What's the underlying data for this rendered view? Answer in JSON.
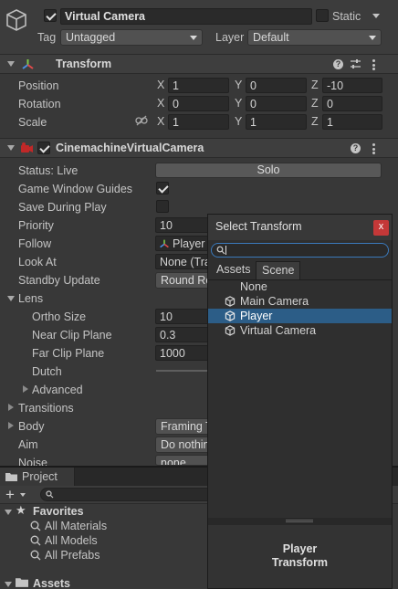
{
  "object": {
    "name": "Virtual Camera",
    "static_label": "Static",
    "tag_label": "Tag",
    "tag_value": "Untagged",
    "layer_label": "Layer",
    "layer_value": "Default"
  },
  "transform": {
    "title": "Transform",
    "rows": [
      {
        "label": "Position",
        "x": "1",
        "y": "0",
        "z": "-10"
      },
      {
        "label": "Rotation",
        "x": "0",
        "y": "0",
        "z": "0"
      },
      {
        "label": "Scale",
        "x": "1",
        "y": "1",
        "z": "1"
      }
    ],
    "axis": {
      "x": "X",
      "y": "Y",
      "z": "Z"
    }
  },
  "vcam": {
    "title": "CinemachineVirtualCamera",
    "status_label": "Status: Live",
    "solo_label": "Solo",
    "game_window_guides": "Game Window Guides",
    "save_during_play": "Save During Play",
    "priority_label": "Priority",
    "priority_value": "10",
    "follow_label": "Follow",
    "follow_value": "Player",
    "look_at_label": "Look At",
    "look_at_value": "None (Tra",
    "standby_label": "Standby Update",
    "standby_value": "Round Ro",
    "lens_label": "Lens",
    "ortho_label": "Ortho Size",
    "ortho_value": "10",
    "near_label": "Near Clip Plane",
    "near_value": "0.3",
    "far_label": "Far Clip Plane",
    "far_value": "1000",
    "dutch_label": "Dutch",
    "advanced_label": "Advanced",
    "transitions_label": "Transitions",
    "body_label": "Body",
    "body_value": "Framing T",
    "aim_label": "Aim",
    "aim_value": "Do nothin",
    "noise_label": "Noise",
    "noise_value": "none"
  },
  "project": {
    "tab_label": "Project",
    "favorites_label": "Favorites",
    "favorites": [
      "All Materials",
      "All Models",
      "All Prefabs"
    ],
    "assets_label": "Assets"
  },
  "popup": {
    "title": "Select Transform",
    "close_label": "x",
    "tabs": [
      "Assets",
      "Scene"
    ],
    "items": [
      {
        "label": "None",
        "icon": false,
        "selected": false
      },
      {
        "label": "Main Camera",
        "icon": true,
        "selected": false
      },
      {
        "label": "Player",
        "icon": true,
        "selected": true
      },
      {
        "label": "Virtual Camera",
        "icon": true,
        "selected": false
      }
    ],
    "preview_line1": "Player",
    "preview_line2": "Transform"
  },
  "colors": {
    "background": "#383838",
    "selection": "#2c5d87",
    "close_button": "#c43838",
    "focus": "#3a79bb"
  }
}
